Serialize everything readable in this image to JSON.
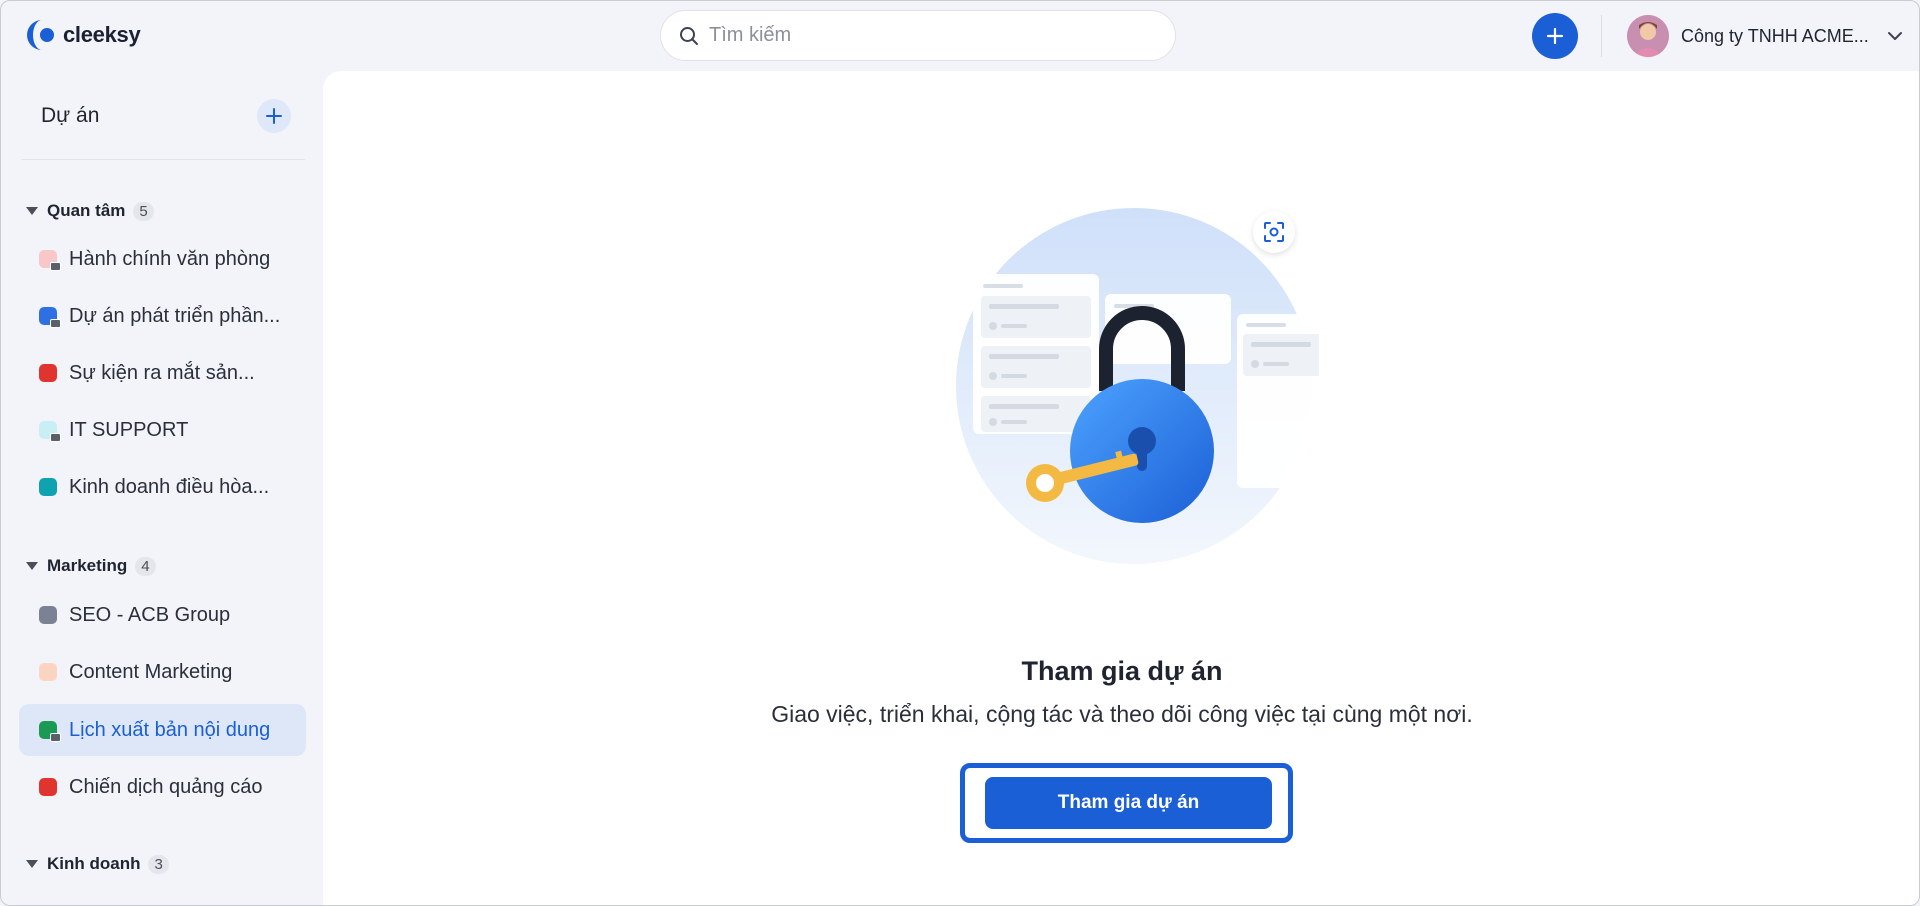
{
  "app": {
    "logo_text": "cleeksy",
    "search_placeholder": "Tìm kiếm",
    "company_name": "Công ty TNHH ACME...",
    "brand_color": "#1b5fd6"
  },
  "sidebar": {
    "title": "Dự án",
    "groups": [
      {
        "name": "Quan tâm",
        "count": "5",
        "items": [
          {
            "label": "Hành chính văn phòng",
            "color": "#f8c7c7",
            "locked": true
          },
          {
            "label": "Dự án phát triển phần...",
            "color": "#2f6fe4",
            "locked": true
          },
          {
            "label": "Sự kiện ra mắt sản...",
            "color": "#e0342e",
            "locked": false
          },
          {
            "label": "IT SUPPORT",
            "color": "#c9eef3",
            "locked": true
          },
          {
            "label": "Kinh doanh điều hòa...",
            "color": "#0fa3b1",
            "locked": false
          }
        ]
      },
      {
        "name": "Marketing",
        "count": "4",
        "items": [
          {
            "label": "SEO - ACB Group",
            "color": "#7c8294",
            "locked": false
          },
          {
            "label": "Content Marketing",
            "color": "#fcd5c2",
            "locked": false
          },
          {
            "label": "Lịch xuất bản nội dung",
            "color": "#1a9a52",
            "locked": true,
            "active": true
          },
          {
            "label": "Chiến dịch quảng cáo",
            "color": "#e0342e",
            "locked": false
          }
        ]
      },
      {
        "name": "Kinh doanh",
        "count": "3",
        "items": []
      }
    ]
  },
  "main": {
    "headline": "Tham gia dự án",
    "subline": "Giao việc, triển khai, cộng tác và theo dõi công việc tại cùng một nơi.",
    "cta_label": "Tham gia dự án"
  }
}
